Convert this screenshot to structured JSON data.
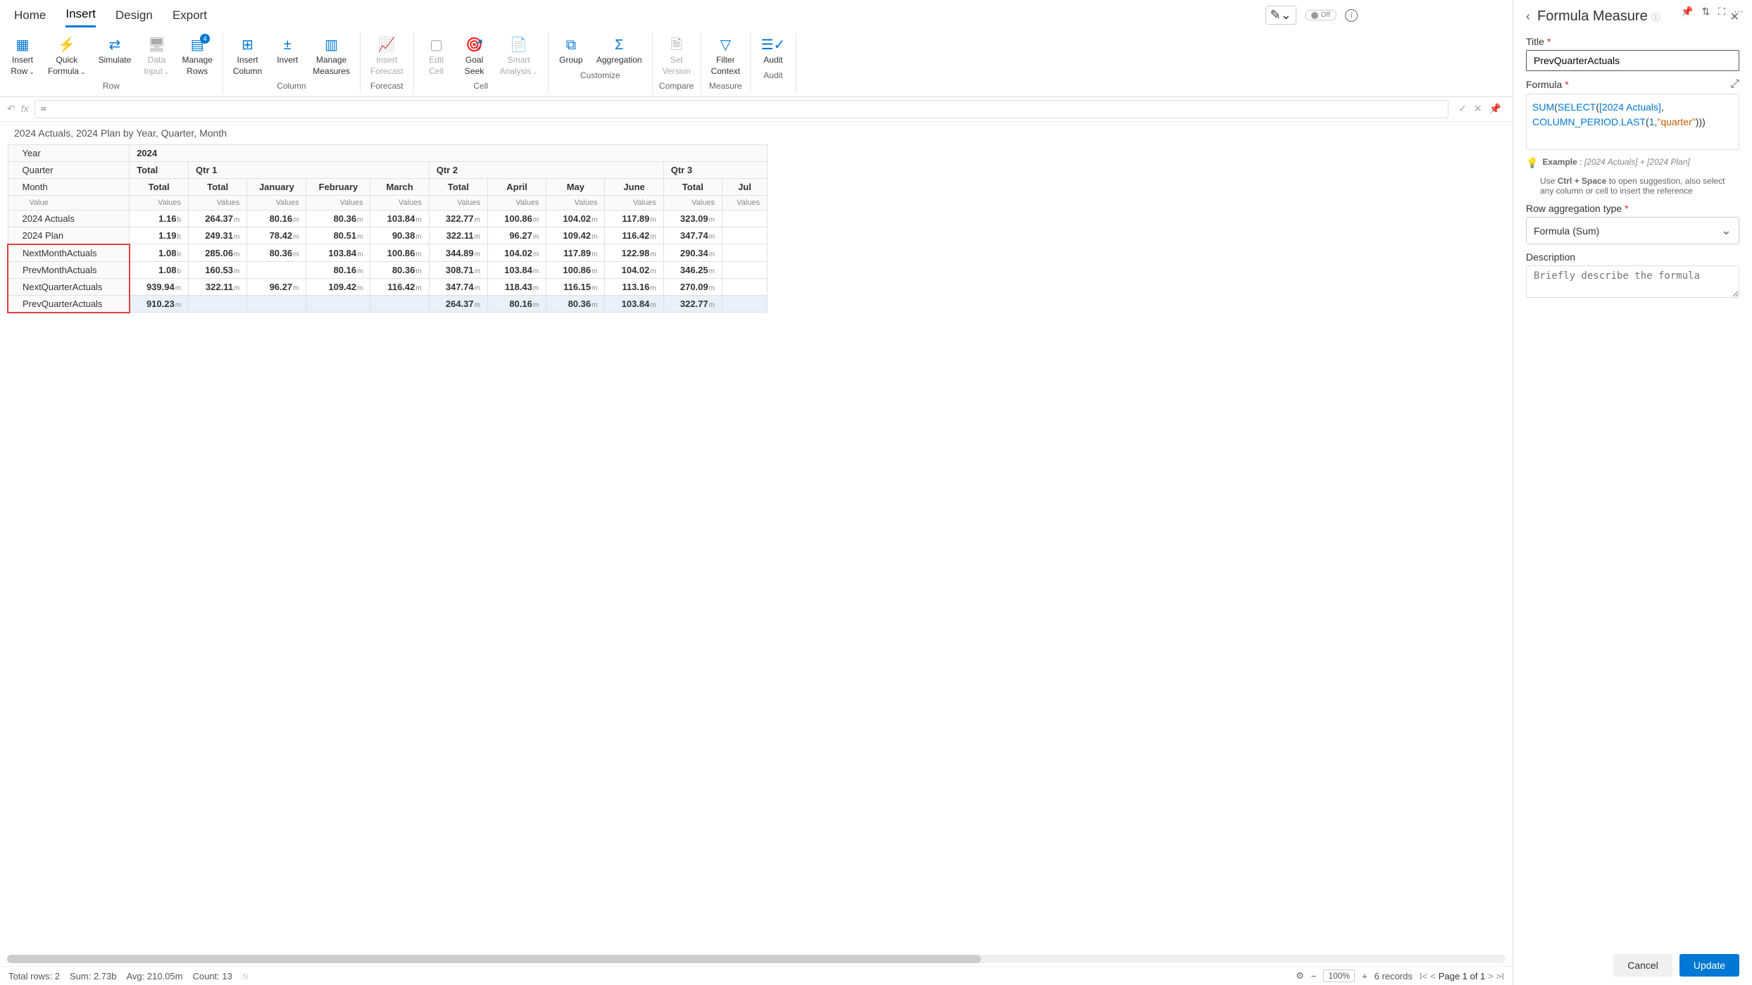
{
  "top_icons": [
    "pin",
    "filter",
    "expand",
    "more"
  ],
  "tabs": {
    "items": [
      "Home",
      "Insert",
      "Design",
      "Export"
    ],
    "active": "Insert",
    "toggle_label": "Off"
  },
  "ribbon": {
    "groups": [
      {
        "label": "Row",
        "buttons": [
          {
            "label1": "Insert",
            "label2": "Row",
            "chev": true
          },
          {
            "label1": "Quick",
            "label2": "Formula",
            "chev": true
          },
          {
            "label1": "Simulate",
            "label2": ""
          },
          {
            "label1": "Data",
            "label2": "Input",
            "chev": true,
            "disabled": true
          },
          {
            "label1": "Manage",
            "label2": "Rows",
            "badge": "4"
          }
        ]
      },
      {
        "label": "Column",
        "buttons": [
          {
            "label1": "Insert",
            "label2": "Column"
          },
          {
            "label1": "Invert",
            "label2": ""
          },
          {
            "label1": "Manage",
            "label2": "Measures"
          }
        ]
      },
      {
        "label": "Forecast",
        "buttons": [
          {
            "label1": "Insert",
            "label2": "Forecast",
            "disabled": true
          }
        ]
      },
      {
        "label": "Cell",
        "buttons": [
          {
            "label1": "Edit",
            "label2": "Cell",
            "disabled": true
          },
          {
            "label1": "Goal",
            "label2": "Seek"
          },
          {
            "label1": "Smart",
            "label2": "Analysis",
            "chev": true,
            "disabled": true
          }
        ]
      },
      {
        "label": "Customize",
        "buttons": [
          {
            "label1": "Group",
            "label2": ""
          },
          {
            "label1": "Aggregation",
            "label2": ""
          }
        ]
      },
      {
        "label": "Compare",
        "buttons": [
          {
            "label1": "Set",
            "label2": "Version",
            "disabled": true
          }
        ]
      },
      {
        "label": "Measure",
        "buttons": [
          {
            "label1": "Filter",
            "label2": "Context"
          }
        ]
      },
      {
        "label": "Audit",
        "buttons": [
          {
            "label1": "Audit",
            "label2": ""
          }
        ]
      }
    ]
  },
  "formula_bar": {
    "value": "="
  },
  "breadcrumb": "2024 Actuals, 2024 Plan by Year, Quarter, Month",
  "table": {
    "row_headers": [
      "Year",
      "Quarter",
      "Month"
    ],
    "value_label": "Value",
    "values_label": "Values",
    "year": "2024",
    "quarters": [
      "Total",
      "Qtr 1",
      "Qtr 2",
      "Qtr 3"
    ],
    "months": [
      "Total",
      "Total",
      "January",
      "February",
      "March",
      "Total",
      "April",
      "May",
      "June",
      "Total",
      "Jul"
    ],
    "rows": [
      {
        "label": "2024 Actuals",
        "cells": [
          [
            "1.16",
            "b"
          ],
          [
            "264.37",
            "m"
          ],
          [
            "80.16",
            "m"
          ],
          [
            "80.36",
            "m"
          ],
          [
            "103.84",
            "m"
          ],
          [
            "322.77",
            "m"
          ],
          [
            "100.86",
            "m"
          ],
          [
            "104.02",
            "m"
          ],
          [
            "117.89",
            "m"
          ],
          [
            "323.09",
            "m"
          ],
          [
            "",
            ""
          ]
        ]
      },
      {
        "label": "2024 Plan",
        "cells": [
          [
            "1.19",
            "b"
          ],
          [
            "249.31",
            "m"
          ],
          [
            "78.42",
            "m"
          ],
          [
            "80.51",
            "m"
          ],
          [
            "90.38",
            "m"
          ],
          [
            "322.11",
            "m"
          ],
          [
            "96.27",
            "m"
          ],
          [
            "109.42",
            "m"
          ],
          [
            "116.42",
            "m"
          ],
          [
            "347.74",
            "m"
          ],
          [
            "",
            ""
          ]
        ]
      },
      {
        "label": "NextMonthActuals",
        "hl": true,
        "first": true,
        "cells": [
          [
            "1.08",
            "b"
          ],
          [
            "285.06",
            "m"
          ],
          [
            "80.36",
            "m"
          ],
          [
            "103.84",
            "m"
          ],
          [
            "100.86",
            "m"
          ],
          [
            "344.89",
            "m"
          ],
          [
            "104.02",
            "m"
          ],
          [
            "117.89",
            "m"
          ],
          [
            "122.98",
            "m"
          ],
          [
            "290.34",
            "m"
          ],
          [
            "",
            ""
          ]
        ]
      },
      {
        "label": "PrevMonthActuals",
        "hl": true,
        "cells": [
          [
            "1.08",
            "b"
          ],
          [
            "160.53",
            "m"
          ],
          [
            "",
            ""
          ],
          [
            "80.16",
            "m"
          ],
          [
            "80.36",
            "m"
          ],
          [
            "308.71",
            "m"
          ],
          [
            "103.84",
            "m"
          ],
          [
            "100.86",
            "m"
          ],
          [
            "104.02",
            "m"
          ],
          [
            "346.25",
            "m"
          ],
          [
            "",
            ""
          ]
        ]
      },
      {
        "label": "NextQuarterActuals",
        "hl": true,
        "cells": [
          [
            "939.94",
            "m"
          ],
          [
            "322.11",
            "m"
          ],
          [
            "96.27",
            "m"
          ],
          [
            "109.42",
            "m"
          ],
          [
            "116.42",
            "m"
          ],
          [
            "347.74",
            "m"
          ],
          [
            "118.43",
            "m"
          ],
          [
            "116.15",
            "m"
          ],
          [
            "113.16",
            "m"
          ],
          [
            "270.09",
            "m"
          ],
          [
            "",
            ""
          ]
        ]
      },
      {
        "label": "PrevQuarterActuals",
        "hl": true,
        "last": true,
        "selected": true,
        "cells": [
          [
            "910.23",
            "m"
          ],
          [
            "",
            ""
          ],
          [
            "",
            ""
          ],
          [
            "",
            ""
          ],
          [
            "",
            ""
          ],
          [
            "264.37",
            "m"
          ],
          [
            "80.16",
            "m"
          ],
          [
            "80.36",
            "m"
          ],
          [
            "103.84",
            "m"
          ],
          [
            "322.77",
            "m"
          ],
          [
            "",
            ""
          ]
        ]
      }
    ]
  },
  "status": {
    "total_rows": "Total rows: 2",
    "sum": "Sum: 2.73b",
    "avg": "Avg: 210.05m",
    "count": "Count: 13",
    "zoom": "100%",
    "records": "6 records",
    "page": "Page 1 of 1"
  },
  "panel": {
    "title": "Formula Measure",
    "field_title_label": "Title",
    "field_title_value": "PrevQuarterActuals",
    "formula_label": "Formula",
    "formula_tokens": [
      "SUM",
      "(",
      "SELECT",
      "(",
      "[2024 Actuals]",
      ",",
      "\n",
      "COLUMN_PERIOD.LAST",
      "(",
      "1",
      ",",
      "\"quarter\"",
      ")",
      ")",
      ")"
    ],
    "example_label": "Example",
    "example_text": "[2024 Actuals] + [2024 Plan]",
    "hint1": "Use Ctrl + Space to open suggestion, also select any column or cell to insert the reference",
    "row_agg_label": "Row aggregation type",
    "row_agg_value": "Formula (Sum)",
    "desc_label": "Description",
    "desc_placeholder": "Briefly describe the formula",
    "cancel": "Cancel",
    "update": "Update"
  }
}
